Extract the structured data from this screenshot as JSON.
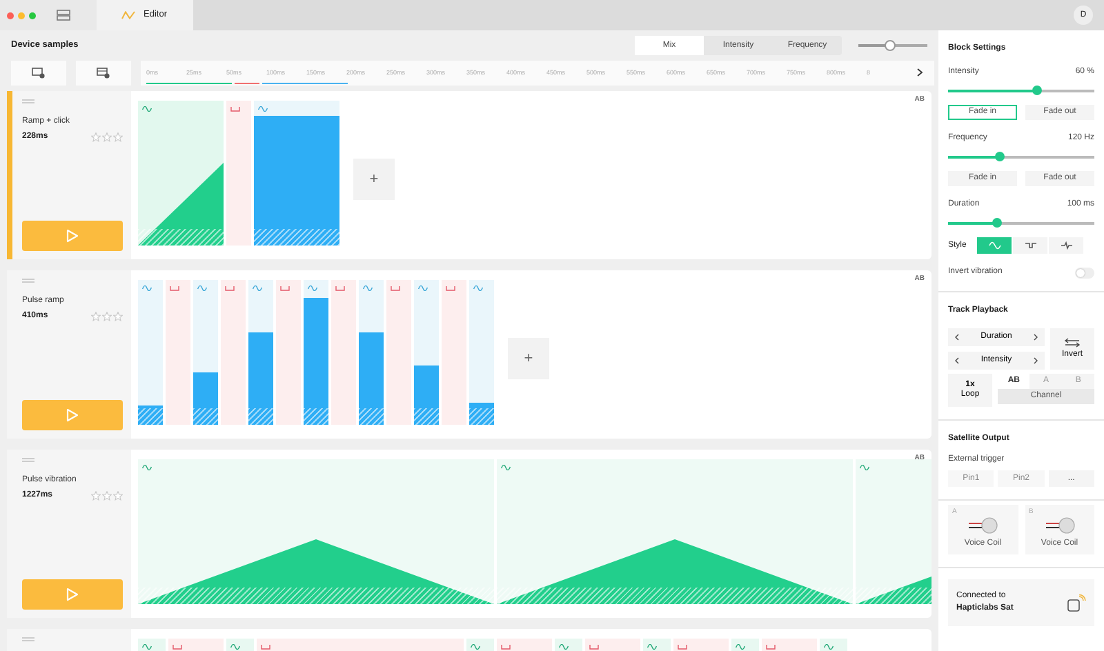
{
  "titlebar": {
    "tab": "Editor",
    "avatar": "D"
  },
  "toolbar": {
    "title": "Device samples",
    "view_modes": [
      {
        "label": "Mix",
        "selected": true
      },
      {
        "label": "Intensity",
        "selected": false
      },
      {
        "label": "Frequency",
        "selected": false
      }
    ],
    "zoom": {
      "level": 0.45
    }
  },
  "ruler": {
    "ticks": [
      "0ms",
      "25ms",
      "50ms",
      "100ms",
      "150ms",
      "200ms",
      "250ms",
      "300ms",
      "350ms",
      "400ms",
      "450ms",
      "500ms",
      "550ms",
      "600ms",
      "650ms",
      "700ms",
      "750ms",
      "800ms",
      "8"
    ]
  },
  "tracks": [
    {
      "name": "Ramp + click",
      "duration": "228ms",
      "selected": true,
      "stars": 0,
      "channel": "AB",
      "add_label": "+",
      "blocks": [
        {
          "kind": "ramp"
        },
        {
          "kind": "click"
        },
        {
          "kind": "constant",
          "level": 0.9
        }
      ]
    },
    {
      "name": "Pulse ramp",
      "duration": "410ms",
      "selected": false,
      "stars": 0,
      "channel": "AB",
      "add_label": "+",
      "blocks": [
        {
          "kind": "pulse",
          "level": 0.13
        },
        {
          "kind": "click"
        },
        {
          "kind": "pulse",
          "level": 0.36
        },
        {
          "kind": "click"
        },
        {
          "kind": "pulse",
          "level": 0.64
        },
        {
          "kind": "click"
        },
        {
          "kind": "pulse",
          "level": 0.88
        },
        {
          "kind": "click"
        },
        {
          "kind": "pulse",
          "level": 0.64
        },
        {
          "kind": "click"
        },
        {
          "kind": "pulse",
          "level": 0.41
        },
        {
          "kind": "click"
        },
        {
          "kind": "pulse",
          "level": 0.15
        }
      ]
    },
    {
      "name": "Pulse vibration",
      "duration": "1227ms",
      "selected": false,
      "stars": 0,
      "channel": "AB",
      "blocks": [
        {
          "kind": "triangle"
        },
        {
          "kind": "triangle"
        },
        {
          "kind": "triangle"
        }
      ]
    },
    {
      "selected": false,
      "blocks": [
        {
          "kind": "tone"
        },
        {
          "kind": "click-wide"
        },
        {
          "kind": "tone"
        },
        {
          "kind": "click-long"
        },
        {
          "kind": "tone"
        },
        {
          "kind": "click-wide"
        },
        {
          "kind": "tone"
        },
        {
          "kind": "click-wide"
        },
        {
          "kind": "tone"
        },
        {
          "kind": "click-wide"
        },
        {
          "kind": "tone"
        },
        {
          "kind": "click-wide"
        },
        {
          "kind": "tone"
        }
      ]
    }
  ],
  "block_settings": {
    "title": "Block Settings",
    "sliders": [
      {
        "label": "Intensity",
        "reading": "60 %",
        "level": 0.6,
        "fades": [
          {
            "label": "Fade in",
            "selected": true
          },
          {
            "label": "Fade out",
            "selected": false
          }
        ]
      },
      {
        "label": "Frequency",
        "reading": "120 Hz",
        "level": 0.35,
        "fades": [
          {
            "label": "Fade in",
            "selected": false
          },
          {
            "label": "Fade out",
            "selected": false
          }
        ]
      },
      {
        "label": "Duration",
        "reading": "100 ms",
        "level": 0.33
      }
    ],
    "style": {
      "label": "Style",
      "options": [
        {
          "kind": "sine",
          "selected": true
        },
        {
          "kind": "square",
          "selected": false
        },
        {
          "kind": "pulse",
          "selected": false
        }
      ]
    },
    "invert": {
      "label": "Invert vibration",
      "on": false
    }
  },
  "track_playback": {
    "title": "Track Playback",
    "steppers": [
      {
        "label": "Duration"
      },
      {
        "label": "Intensity"
      }
    ],
    "invert": "Invert",
    "loop": {
      "value": "1x",
      "label": "Loop"
    },
    "channels": [
      {
        "label": "AB",
        "selected": true
      },
      {
        "label": "A",
        "selected": false
      },
      {
        "label": "B",
        "selected": false
      }
    ],
    "channel_label": "Channel"
  },
  "satellite_output": {
    "title": "Satellite Output",
    "trigger_label": "External trigger",
    "pins": [
      {
        "label": "Pin1",
        "disabled": true
      },
      {
        "label": "Pin2",
        "disabled": true
      },
      {
        "label": "...",
        "disabled": false
      }
    ],
    "outputs": [
      {
        "channel": "A",
        "label": "Voice Coil"
      },
      {
        "channel": "B",
        "label": "Voice Coil"
      }
    ],
    "connection": {
      "text": "Connected to",
      "device": "Hapticlabs Sat"
    }
  }
}
